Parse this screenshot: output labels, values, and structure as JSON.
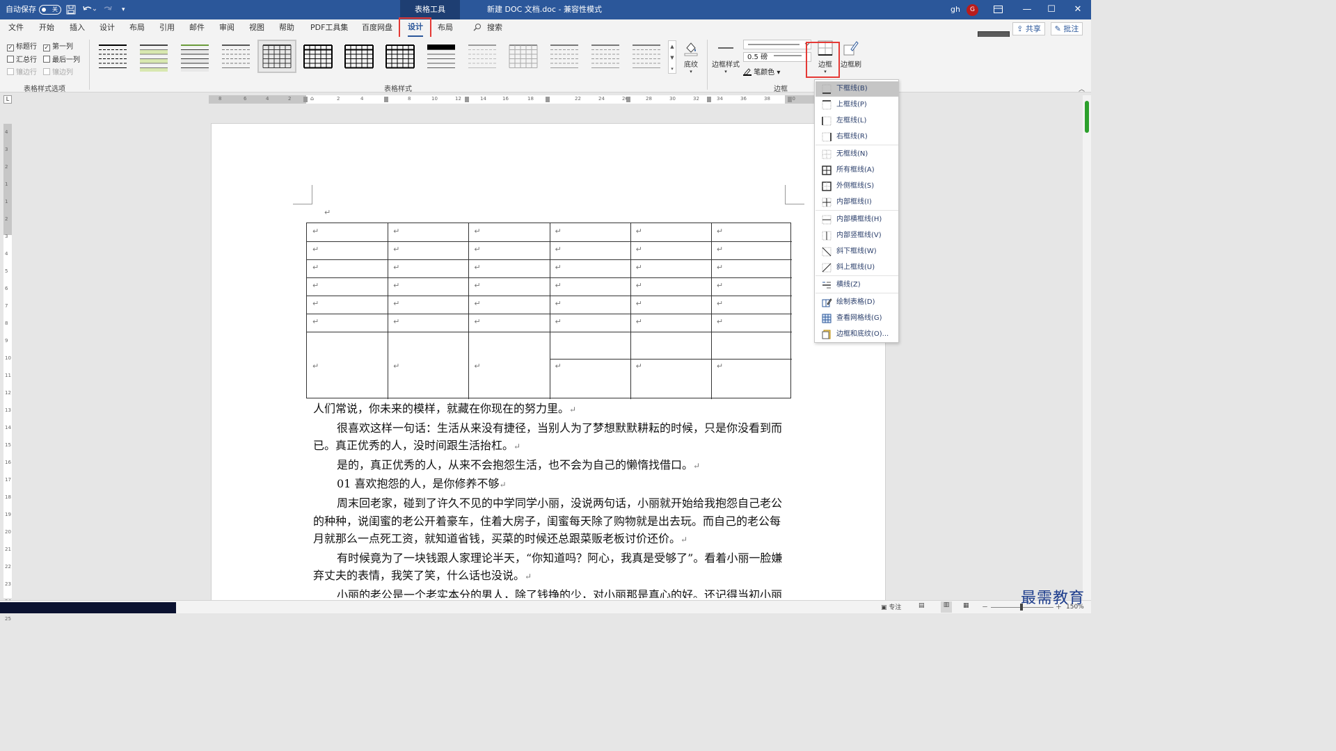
{
  "titlebar": {
    "autosave_label": "自动保存",
    "autosave_state": "关",
    "context_tab": "表格工具",
    "doc_title": "新建 DOC 文档.doc  -  兼容性模式",
    "user": "gh",
    "avatar_letter": "G",
    "minimize": "—",
    "maximize": "☐",
    "close": "✕"
  },
  "tabs": [
    "文件",
    "开始",
    "插入",
    "设计",
    "布局",
    "引用",
    "邮件",
    "审阅",
    "视图",
    "帮助",
    "PDF工具集",
    "百度网盘",
    "设计",
    "布局"
  ],
  "active_tab_index": 12,
  "search_label": "搜索",
  "share_label": "共享",
  "comment_label": "批注",
  "ribbon": {
    "style_options": {
      "header_row": "标题行",
      "first_column": "第一列",
      "total_row": "汇总行",
      "last_column": "最后一列",
      "banded_rows": "镶边行",
      "banded_columns": "镶边列",
      "checked": {
        "header_row": true,
        "first_column": true,
        "total_row": false,
        "last_column": false,
        "banded_rows": false,
        "banded_columns": false
      },
      "group_label": "表格样式选项"
    },
    "table_styles": {
      "group_label": "表格样式",
      "selected_index": 4,
      "count": 14
    },
    "shading": "底纹",
    "borders": {
      "border_styles": "边框样式",
      "pen_weight": "0.5 磅",
      "pen_color": "笔颜色",
      "borders_button": "边框",
      "border_painter": "边框刷",
      "group_label": "边框"
    }
  },
  "ruler": {
    "h_labels": [
      "8",
      "6",
      "4",
      "2",
      "2",
      "4",
      "6",
      "8",
      "10",
      "12",
      "14",
      "16",
      "18",
      "22",
      "24",
      "26",
      "28",
      "30",
      "32",
      "34",
      "36",
      "38",
      "40"
    ],
    "v_labels": [
      "4",
      "3",
      "2",
      "1",
      "1",
      "2",
      "3",
      "4",
      "5",
      "6",
      "7",
      "8",
      "9",
      "10",
      "11",
      "12",
      "13",
      "14",
      "15",
      "16",
      "17",
      "18",
      "19",
      "20",
      "21",
      "22",
      "23",
      "24",
      "25"
    ]
  },
  "document": {
    "para_mark": "↵",
    "table": {
      "columns": 6,
      "rows": 6,
      "merged_row_split_columns": [
        3,
        4,
        5
      ]
    },
    "paragraphs": [
      {
        "text": "人们常说，你未来的模样，就藏在你现在的努力里。",
        "indent": false
      },
      {
        "text": "很喜欢这样一句话：生活从来没有捷径，当别人为了梦想默默耕耘的时候，只是你没看到而已。真正优秀的人，没时间跟生活抬杠。",
        "indent": true
      },
      {
        "text": "是的，真正优秀的人，从来不会抱怨生活，也不会为自己的懒惰找借口。",
        "indent": true
      },
      {
        "text": "01  喜欢抱怨的人，是你修养不够",
        "indent": true
      },
      {
        "text": "周末回老家，碰到了许久不见的中学同学小丽，没说两句话，小丽就开始给我抱怨自己老公的种种，说闺蜜的老公开着豪车，住着大房子，闺蜜每天除了购物就是出去玩。而自己的老公每月就那么一点死工资，就知道省钱，买菜的时候还总跟菜贩老板讨价还价。",
        "indent": true
      },
      {
        "text": "有时候竟为了一块钱跟人家理论半天，“你知道吗？阿心，我真是受够了”。看着小丽一脸嫌弃丈夫的表情，我笑了笑，什么话也没说。",
        "indent": true
      },
      {
        "text": "小丽的老公是一个老实本分的男人，除了钱挣的少，对小丽那是真心的好。还记得当初小丽经常在我们耳边说，老公如何对她好，惧不得让所有人都知道她嫁了个好老公，可现在",
        "indent": true
      }
    ]
  },
  "borders_menu": [
    {
      "label": "下框线(B)",
      "icon": "border-bottom-icon",
      "highlighted": true
    },
    {
      "label": "上框线(P)",
      "icon": "border-top-icon"
    },
    {
      "label": "左框线(L)",
      "icon": "border-left-icon"
    },
    {
      "label": "右框线(R)",
      "icon": "border-right-icon"
    },
    {
      "label": "无框线(N)",
      "icon": "border-none-icon"
    },
    {
      "label": "所有框线(A)",
      "icon": "border-all-icon"
    },
    {
      "label": "外侧框线(S)",
      "icon": "border-outside-icon"
    },
    {
      "label": "内部框线(I)",
      "icon": "border-inside-icon"
    },
    {
      "label": "内部横框线(H)",
      "icon": "border-inside-horizontal-icon"
    },
    {
      "label": "内部竖框线(V)",
      "icon": "border-inside-vertical-icon"
    },
    {
      "label": "斜下框线(W)",
      "icon": "diagonal-down-border-icon"
    },
    {
      "label": "斜上框线(U)",
      "icon": "diagonal-up-border-icon"
    },
    {
      "label": "横线(Z)",
      "icon": "horizontal-line-icon"
    },
    {
      "label": "绘制表格(D)",
      "icon": "draw-table-icon"
    },
    {
      "label": "查看网格线(G)",
      "icon": "view-gridlines-icon"
    },
    {
      "label": "边框和底纹(O)...",
      "icon": "borders-shading-icon"
    }
  ],
  "statusbar": {
    "focus": "专注",
    "zoom": "150%"
  },
  "watermark": "最需教育",
  "colors": {
    "brand": "#2b579a",
    "highlight_box": "#e53935"
  }
}
